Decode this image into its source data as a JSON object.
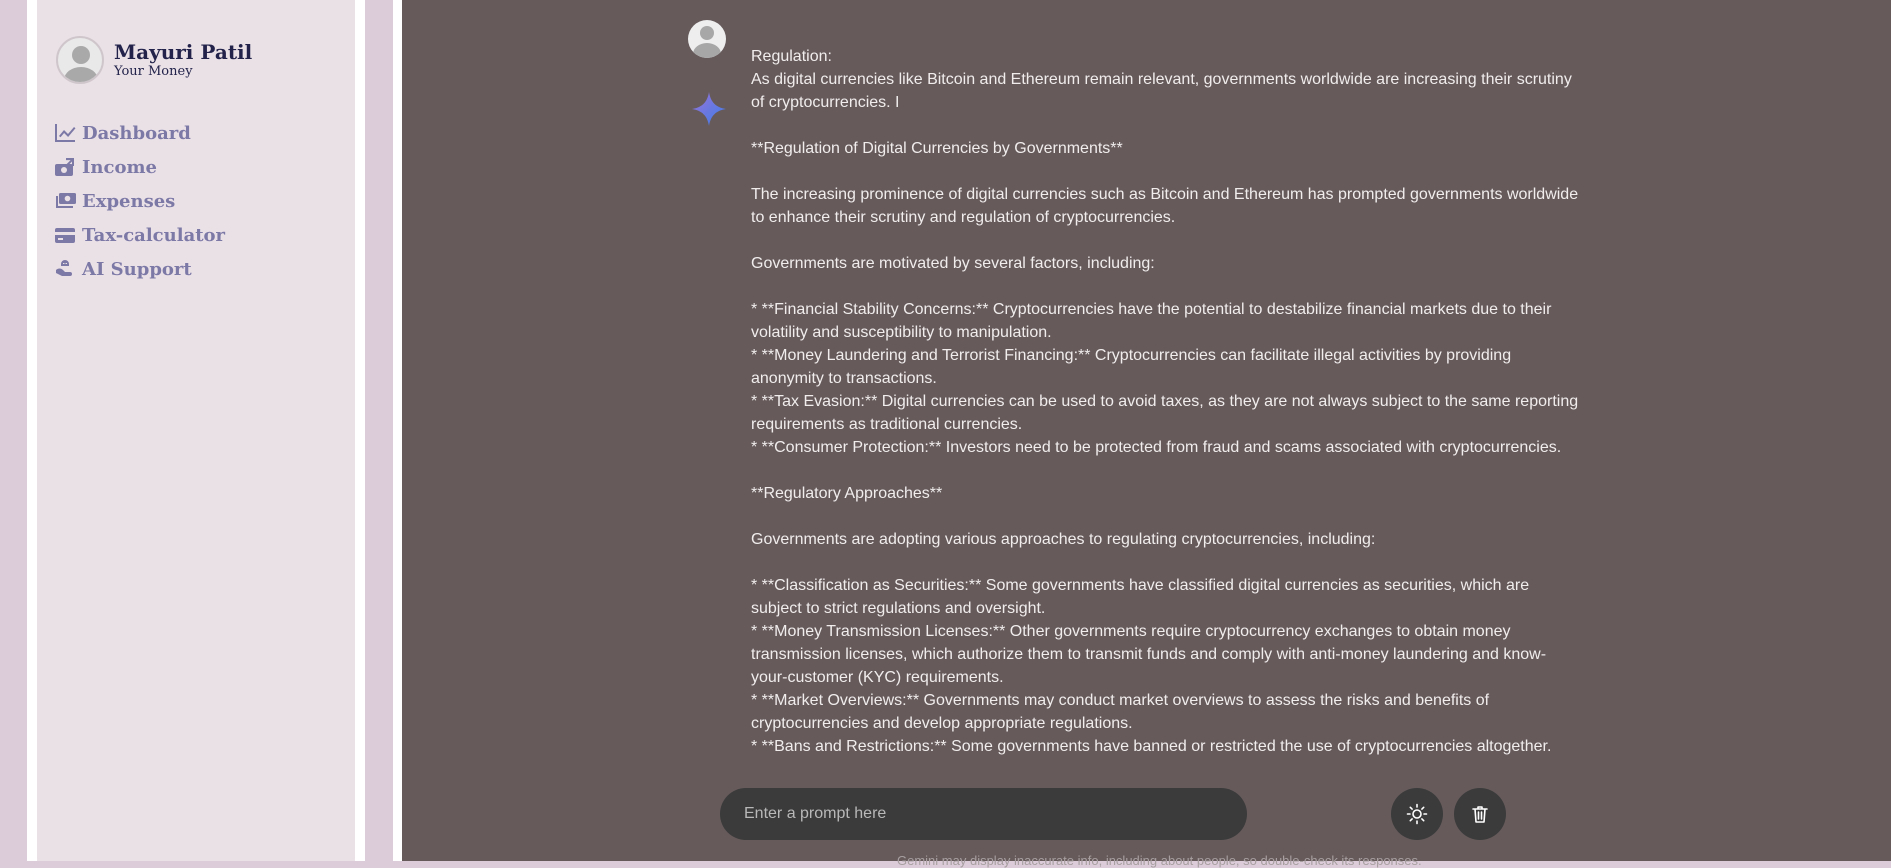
{
  "profile": {
    "name": "Mayuri Patil",
    "subtitle": "Your Money"
  },
  "nav": [
    {
      "label": "Dashboard",
      "icon": "chart-line-icon"
    },
    {
      "label": "Income",
      "icon": "money-bill-trend-icon"
    },
    {
      "label": "Expenses",
      "icon": "money-bills-icon"
    },
    {
      "label": "Tax-calculator",
      "icon": "credit-card-icon"
    },
    {
      "label": "AI Support",
      "icon": "robot-hand-icon"
    }
  ],
  "chat": {
    "user_message": "Regulation:\nAs digital currencies like Bitcoin and Ethereum remain relevant, governments worldwide are increasing their scrutiny of cryptocurrencies. I",
    "response": "**Regulation of Digital Currencies by Governments**\n\nThe increasing prominence of digital currencies such as Bitcoin and Ethereum has prompted governments worldwide to enhance their scrutiny and regulation of cryptocurrencies.\n\nGovernments are motivated by several factors, including:\n\n* **Financial Stability Concerns:** Cryptocurrencies have the potential to destabilize financial markets due to their volatility and susceptibility to manipulation.\n* **Money Laundering and Terrorist Financing:** Cryptocurrencies can facilitate illegal activities by providing anonymity to transactions.\n* **Tax Evasion:** Digital currencies can be used to avoid taxes, as they are not always subject to the same reporting requirements as traditional currencies.\n* **Consumer Protection:** Investors need to be protected from fraud and scams associated with cryptocurrencies.\n\n**Regulatory Approaches**\n\nGovernments are adopting various approaches to regulating cryptocurrencies, including:\n\n* **Classification as Securities:** Some governments have classified digital currencies as securities, which are subject to strict regulations and oversight.\n* **Money Transmission Licenses:** Other governments require cryptocurrency exchanges to obtain money transmission licenses, which authorize them to transmit funds and comply with anti-money laundering and know-your-customer (KYC) requirements.\n* **Market Overviews:** Governments may conduct market overviews to assess the risks and benefits of cryptocurrencies and develop appropriate regulations.\n* **Bans and Restrictions:** Some governments have banned or restricted the use of cryptocurrencies altogether."
  },
  "input": {
    "placeholder": "Enter a prompt here",
    "value": ""
  },
  "buttons": {
    "theme_icon": "sun-icon",
    "delete_icon": "trash-icon"
  },
  "disclaimer": "Gemini may display inaccurate info, including about people, so double-check its responses.",
  "colors": {
    "sidebar_bg": "#eae1e7",
    "main_bg": "#665a5b",
    "nav_text": "#7d79a6",
    "name_text": "#22224a"
  }
}
